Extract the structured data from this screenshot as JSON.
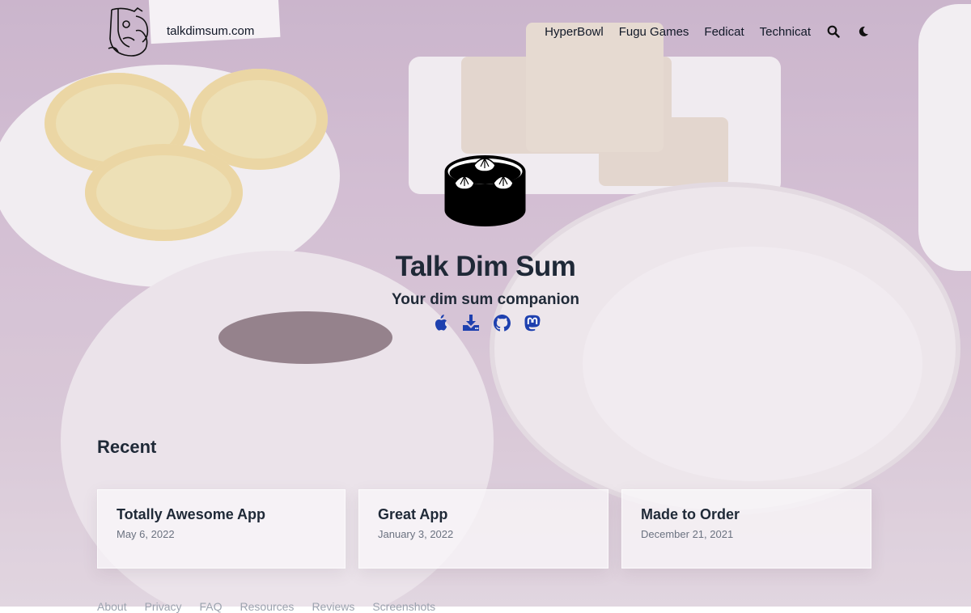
{
  "header": {
    "site_name": "talkdimsum.com",
    "nav": [
      "HyperBowl",
      "Fugu Games",
      "Fedicat",
      "Technicat"
    ],
    "icons": [
      "search-icon",
      "moon-icon"
    ]
  },
  "hero": {
    "title": "Talk Dim Sum",
    "subtitle": "Your dim sum companion",
    "link_icons": [
      "apple-icon",
      "download-icon",
      "github-icon",
      "mastodon-icon"
    ],
    "link_color": "#1e40af"
  },
  "recent": {
    "heading": "Recent",
    "posts": [
      {
        "title": "Totally Awesome App",
        "date": "May 6, 2022"
      },
      {
        "title": "Great App",
        "date": "January 3, 2022"
      },
      {
        "title": "Made to Order",
        "date": "December 21, 2021"
      }
    ]
  },
  "footer": {
    "links": [
      "About",
      "Privacy",
      "FAQ",
      "Resources",
      "Reviews",
      "Screenshots"
    ]
  }
}
